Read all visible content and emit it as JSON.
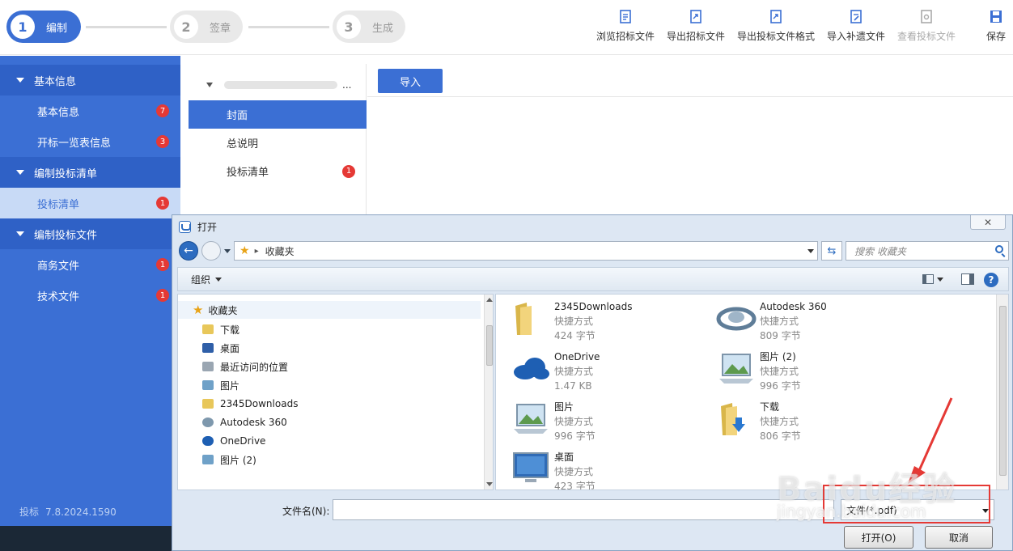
{
  "steps": [
    {
      "num": "1",
      "label": "编制"
    },
    {
      "num": "2",
      "label": "签章"
    },
    {
      "num": "3",
      "label": "生成"
    }
  ],
  "toolbar": {
    "browse": "浏览招标文件",
    "export_bid": "导出招标文件",
    "export_format": "导出投标文件格式",
    "import_supplement": "导入补遗文件",
    "view_bid": "查看投标文件",
    "save": "保存"
  },
  "sidebar": {
    "sections": [
      {
        "label": "基本信息"
      },
      {
        "label": "编制投标清单"
      },
      {
        "label": "编制投标文件"
      }
    ],
    "items": [
      {
        "label": "基本信息",
        "badge": "7"
      },
      {
        "label": "开标一览表信息",
        "badge": "3"
      },
      {
        "label": "投标清单",
        "badge": "1"
      },
      {
        "label": "商务文件",
        "badge": "1"
      },
      {
        "label": "技术文件",
        "badge": "1"
      }
    ],
    "version_label": "投标",
    "version": "7.8.2024.1590"
  },
  "tree": {
    "root_suffix": "...",
    "items": [
      {
        "label": "封面",
        "badge": ""
      },
      {
        "label": "总说明",
        "badge": ""
      },
      {
        "label": "投标清单",
        "badge": "1"
      }
    ]
  },
  "content": {
    "import_label": "导入"
  },
  "dialog": {
    "title": "打开",
    "address": "收藏夹",
    "search_placeholder": "搜索 收藏夹",
    "organize": "组织",
    "nav_root": "收藏夹",
    "nav_items": [
      {
        "label": "下载",
        "icon": "download-folder-icon"
      },
      {
        "label": "桌面",
        "icon": "desktop-icon"
      },
      {
        "label": "最近访问的位置",
        "icon": "recent-places-icon"
      },
      {
        "label": "图片",
        "icon": "pictures-icon"
      },
      {
        "label": "2345Downloads",
        "icon": "folder-icon"
      },
      {
        "label": "Autodesk 360",
        "icon": "autodesk-icon"
      },
      {
        "label": "OneDrive",
        "icon": "onedrive-icon"
      },
      {
        "label": "图片 (2)",
        "icon": "pictures-icon"
      }
    ],
    "files": [
      {
        "name": "2345Downloads",
        "type": "快捷方式",
        "size": "424 字节",
        "icon": "folder-icon"
      },
      {
        "name": "Autodesk 360",
        "type": "快捷方式",
        "size": "809 字节",
        "icon": "autodesk-icon"
      },
      {
        "name": "OneDrive",
        "type": "快捷方式",
        "size": "1.47 KB",
        "icon": "onedrive-icon"
      },
      {
        "name": "图片 (2)",
        "type": "快捷方式",
        "size": "996 字节",
        "icon": "pictures-icon"
      },
      {
        "name": "图片",
        "type": "快捷方式",
        "size": "996 字节",
        "icon": "pictures-icon"
      },
      {
        "name": "下载",
        "type": "快捷方式",
        "size": "806 字节",
        "icon": "download-folder-icon"
      },
      {
        "name": "桌面",
        "type": "快捷方式",
        "size": "423 字节",
        "icon": "desktop-icon"
      }
    ],
    "filename_label": "文件名(N):",
    "filename_value": "",
    "filetype": "文件(*.pdf)",
    "open_label": "打开(O)",
    "cancel_label": "取消"
  },
  "watermark": {
    "brand": "Baidu经验",
    "url": "jingyan.baidu.com"
  },
  "colors": {
    "primary": "#3b6fd4",
    "badge": "#e53935",
    "annotation": "#e53935"
  }
}
